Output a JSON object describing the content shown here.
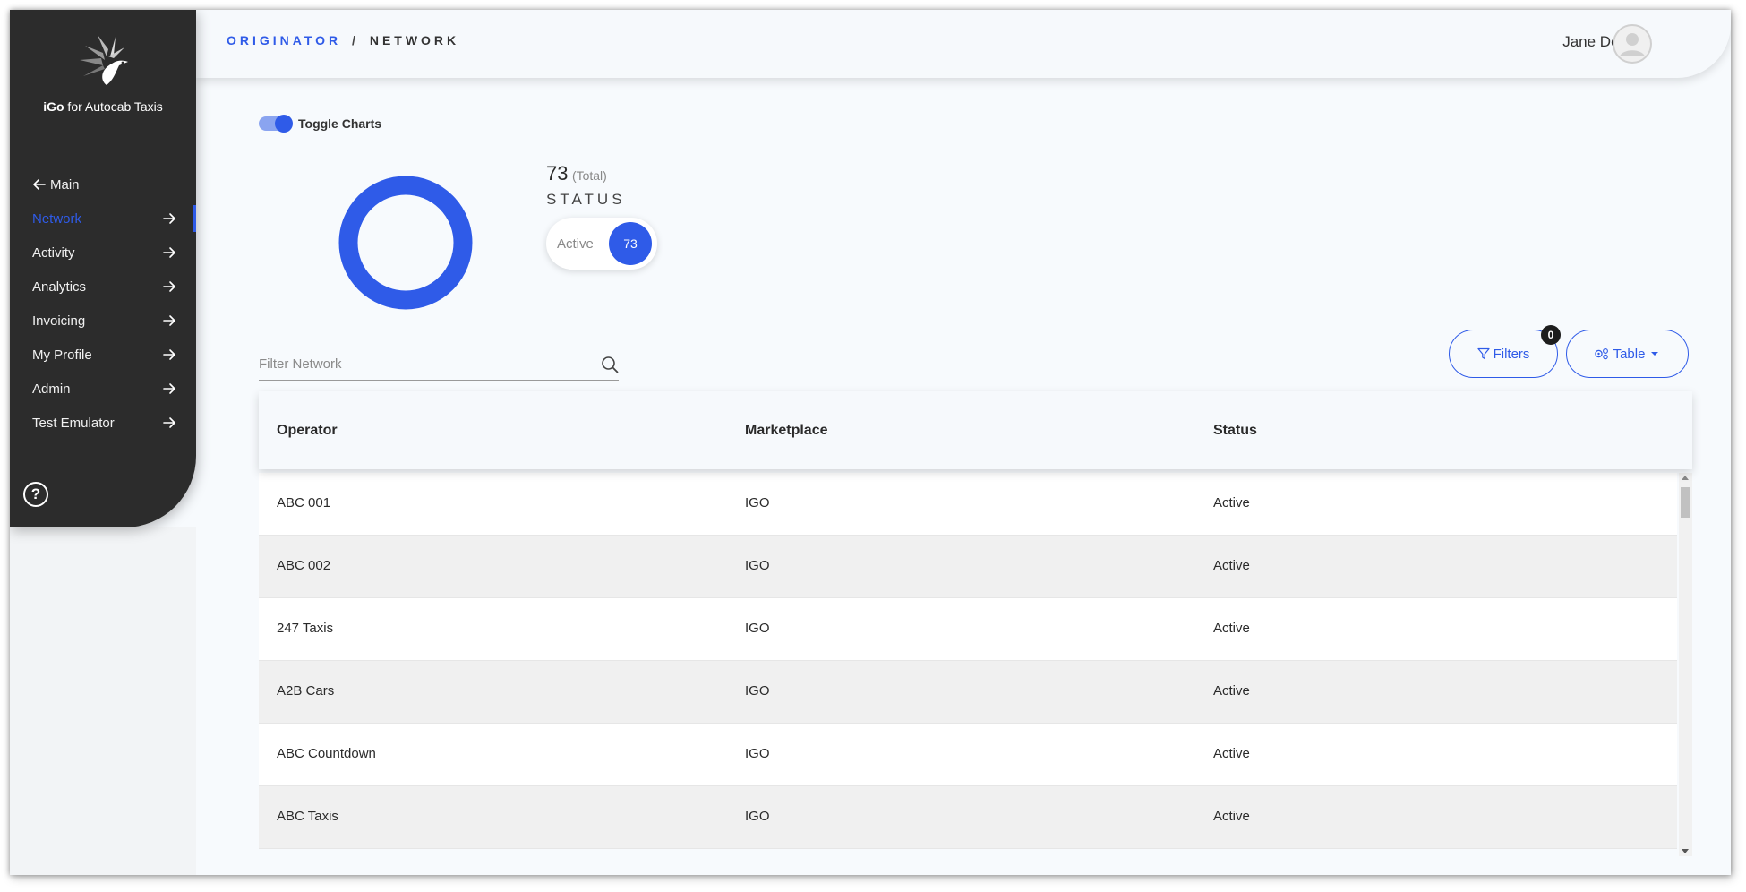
{
  "sidebar": {
    "brand_bold": "iGo",
    "brand_rest": " for Autocab Taxis",
    "back_label": "Main",
    "items": [
      {
        "label": "Network",
        "active": true
      },
      {
        "label": "Activity"
      },
      {
        "label": "Analytics"
      },
      {
        "label": "Invoicing"
      },
      {
        "label": "My Profile"
      },
      {
        "label": "Admin"
      },
      {
        "label": "Test Emulator"
      }
    ],
    "help_glyph": "?"
  },
  "header": {
    "crumb_root": "ORIGINATOR",
    "crumb_sep": "/",
    "crumb_page": "NETWORK",
    "user_name": "Jane Doe"
  },
  "charts": {
    "toggle_label": "Toggle Charts",
    "toggle_on": true,
    "total": "73",
    "total_label": "(Total)",
    "status_title": "STATUS",
    "status_label": "Active",
    "status_count": "73"
  },
  "filter": {
    "placeholder": "Filter Network"
  },
  "buttons": {
    "filters_label": "Filters",
    "filters_count": "0",
    "table_label": "Table"
  },
  "table": {
    "columns": [
      "Operator",
      "Marketplace",
      "Status"
    ],
    "rows": [
      [
        "ABC 001",
        "IGO",
        "Active"
      ],
      [
        "ABC 002",
        "IGO",
        "Active"
      ],
      [
        "247 Taxis",
        "IGO",
        "Active"
      ],
      [
        "A2B Cars",
        "IGO",
        "Active"
      ],
      [
        "ABC Countdown",
        "IGO",
        "Active"
      ],
      [
        "ABC Taxis",
        "IGO",
        "Active"
      ]
    ]
  },
  "colors": {
    "accent": "#2f5be8",
    "sidebar_bg": "#2c2c2c",
    "page_bg": "#f7fafd"
  }
}
